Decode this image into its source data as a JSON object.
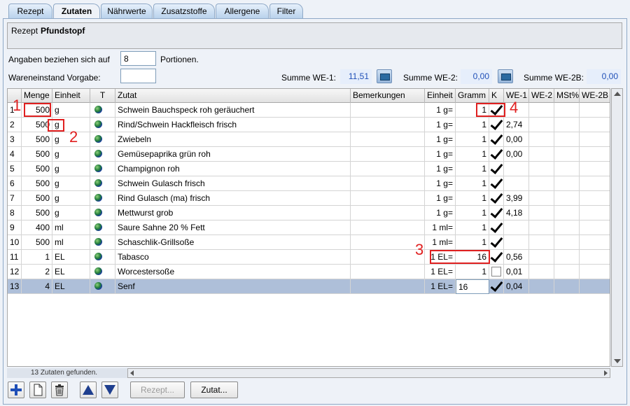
{
  "tabs": [
    "Rezept",
    "Zutaten",
    "Nährwerte",
    "Zusatzstoffe",
    "Allergene",
    "Filter"
  ],
  "active_tab": "Zutaten",
  "rezept": {
    "label": "Rezept",
    "name": "Pfundstopf"
  },
  "portions": {
    "label": "Angaben beziehen sich auf",
    "value": "8",
    "suffix": "Portionen."
  },
  "stock": {
    "label": "Wareneinstand Vorgabe:",
    "value": ""
  },
  "sums": [
    {
      "label": "Summe WE-1:",
      "value": "11,51"
    },
    {
      "label": "Summe WE-2:",
      "value": "0,00"
    },
    {
      "label": "Summe WE-2B:",
      "value": "0,00"
    }
  ],
  "columns": [
    "Menge",
    "Einheit",
    "T",
    "Zutat",
    "Bemerkungen",
    "Einheit",
    "Gramm",
    "K",
    "WE-1",
    "WE-2",
    "MSt%",
    "WE-2B"
  ],
  "rows": [
    {
      "n": "1",
      "menge": "500",
      "einheit": "g",
      "zutat": "Schwein Bauchspeck roh geräuchert",
      "bem": "",
      "e2": "1 g=",
      "gramm": "1",
      "k": true,
      "we1": ""
    },
    {
      "n": "2",
      "menge": "500",
      "einheit": "g",
      "zutat": "Rind/Schwein Hackfleisch frisch",
      "bem": "",
      "e2": "1 g=",
      "gramm": "1",
      "k": true,
      "we1": "2,74"
    },
    {
      "n": "3",
      "menge": "500",
      "einheit": "g",
      "zutat": "Zwiebeln",
      "bem": "",
      "e2": "1 g=",
      "gramm": "1",
      "k": true,
      "we1": "0,00"
    },
    {
      "n": "4",
      "menge": "500",
      "einheit": "g",
      "zutat": "Gemüsepaprika grün roh",
      "bem": "",
      "e2": "1 g=",
      "gramm": "1",
      "k": true,
      "we1": "0,00"
    },
    {
      "n": "5",
      "menge": "500",
      "einheit": "g",
      "zutat": "Champignon roh",
      "bem": "",
      "e2": "1 g=",
      "gramm": "1",
      "k": true,
      "we1": ""
    },
    {
      "n": "6",
      "menge": "500",
      "einheit": "g",
      "zutat": "Schwein Gulasch frisch",
      "bem": "",
      "e2": "1 g=",
      "gramm": "1",
      "k": true,
      "we1": ""
    },
    {
      "n": "7",
      "menge": "500",
      "einheit": "g",
      "zutat": "Rind Gulasch (ma) frisch",
      "bem": "",
      "e2": "1 g=",
      "gramm": "1",
      "k": true,
      "we1": "3,99"
    },
    {
      "n": "8",
      "menge": "500",
      "einheit": "g",
      "zutat": "Mettwurst grob",
      "bem": "",
      "e2": "1 g=",
      "gramm": "1",
      "k": true,
      "we1": "4,18"
    },
    {
      "n": "9",
      "menge": "400",
      "einheit": "ml",
      "zutat": "Saure Sahne 20 % Fett",
      "bem": "",
      "e2": "1 ml=",
      "gramm": "1",
      "k": true,
      "we1": ""
    },
    {
      "n": "10",
      "menge": "500",
      "einheit": "ml",
      "zutat": "Schaschlik-Grillsoße",
      "bem": "",
      "e2": "1 ml=",
      "gramm": "1",
      "k": true,
      "we1": ""
    },
    {
      "n": "11",
      "menge": "1",
      "einheit": "EL",
      "zutat": "Tabasco",
      "bem": "",
      "e2": "1 EL=",
      "gramm": "16",
      "k": true,
      "we1": "0,56"
    },
    {
      "n": "12",
      "menge": "2",
      "einheit": "EL",
      "zutat": "Worcestersoße",
      "bem": "",
      "e2": "1 EL=",
      "gramm": "1",
      "k": false,
      "we1": "0,01"
    },
    {
      "n": "13",
      "menge": "4",
      "einheit": "EL",
      "zutat": "Senf",
      "bem": "",
      "e2": "1 EL=",
      "gramm": "16",
      "k": true,
      "we1": "0,04"
    }
  ],
  "selected_row": 13,
  "status": "13 Zutaten gefunden.",
  "toolbar": {
    "rezept": "Rezept...",
    "zutat": "Zutat..."
  },
  "annotations": [
    "1",
    "2",
    "3",
    "4"
  ]
}
